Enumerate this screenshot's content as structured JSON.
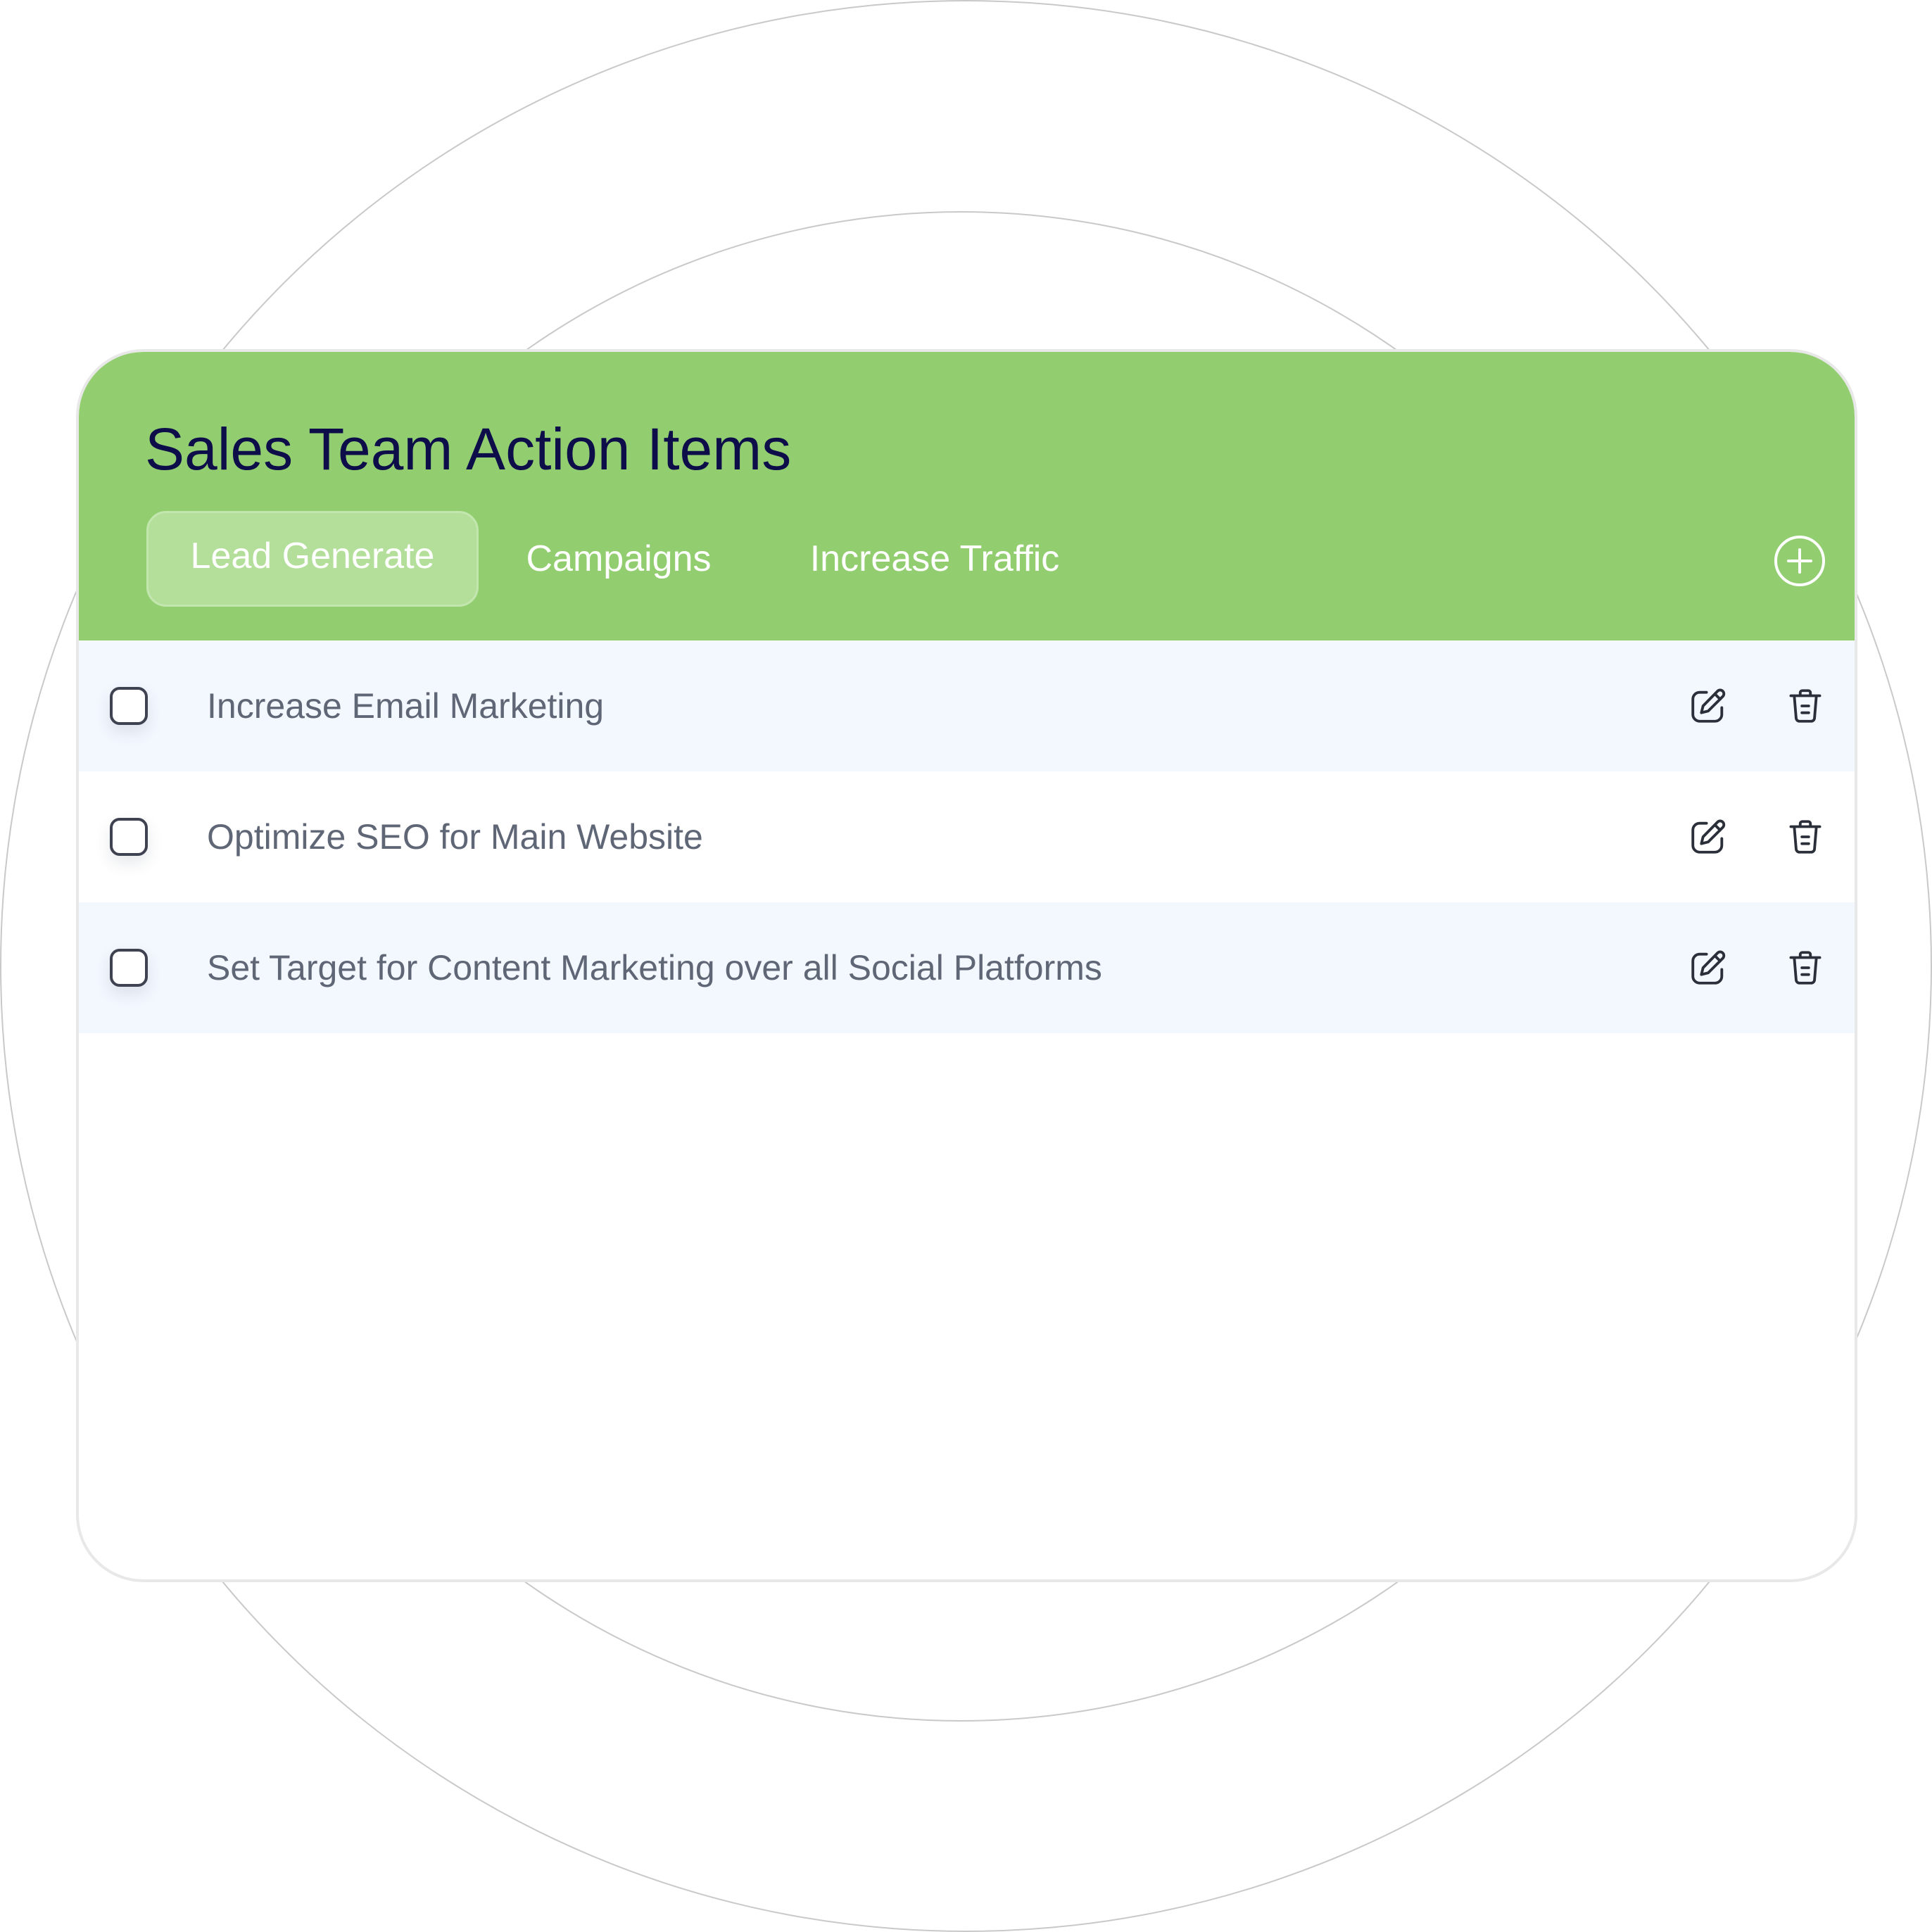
{
  "header": {
    "title": "Sales Team Action Items",
    "background_color": "#92ce70",
    "title_color": "#0d0d4a"
  },
  "tabs": [
    {
      "label": "Lead Generate",
      "active": true
    },
    {
      "label": "Campaigns",
      "active": false
    },
    {
      "label": "Increase Traffic",
      "active": false
    }
  ],
  "add_button": {
    "icon": "plus-circle-icon"
  },
  "tasks": [
    {
      "text": "Increase Email Marketing",
      "checked": false,
      "edit_icon": "edit-icon",
      "delete_icon": "trash-icon"
    },
    {
      "text": "Optimize SEO for Main Website",
      "checked": false,
      "edit_icon": "edit-icon",
      "delete_icon": "trash-icon"
    },
    {
      "text": "Set Target for Content Marketing over all Social Platforms",
      "checked": false,
      "edit_icon": "edit-icon",
      "delete_icon": "trash-icon"
    }
  ],
  "colors": {
    "row_shade": "#f3f7fe",
    "task_text": "#5f6675",
    "active_tab_bg": "#b4df9b"
  }
}
